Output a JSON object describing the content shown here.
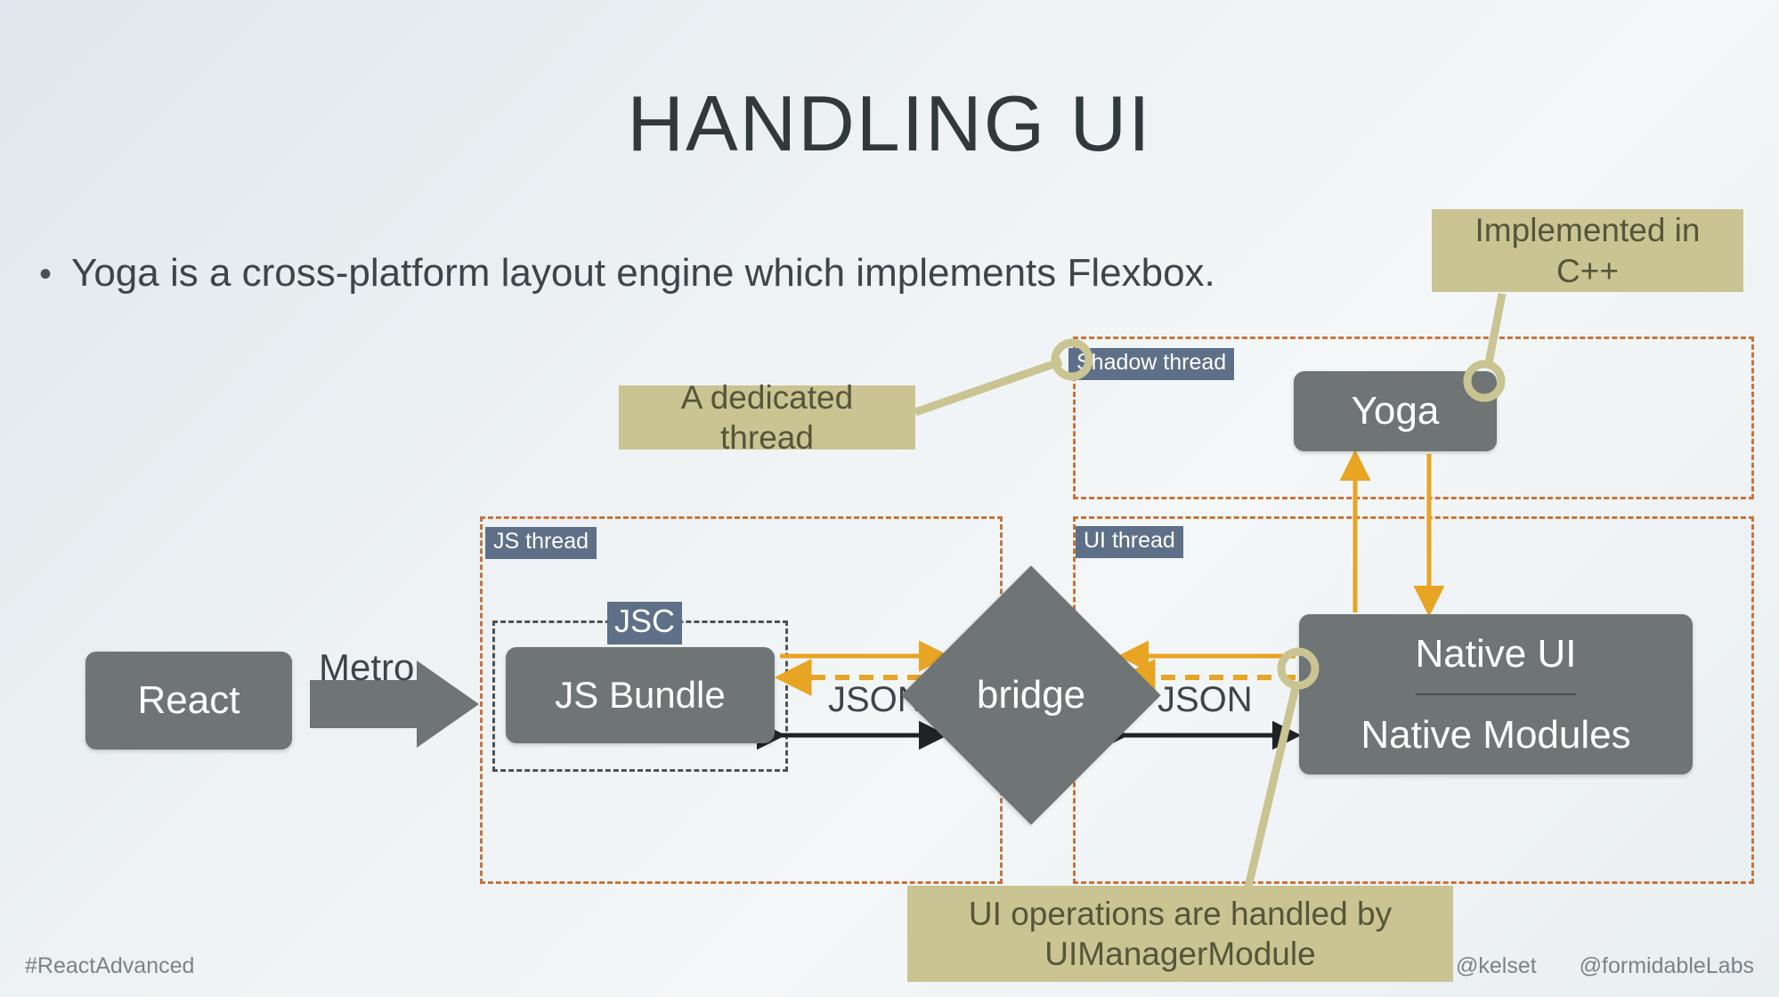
{
  "slide": {
    "title": "HANDLING UI",
    "bullet": {
      "marker": "•",
      "text": "Yoga is a cross-platform layout engine which implements Flexbox."
    }
  },
  "colors": {
    "background_from": "#dfe8ec",
    "background_to": "#e9eef1",
    "node_gray": "#6e7574",
    "thread_border_orange": "#c9733a",
    "chip_blue": "#5d7087",
    "callout_khaki": "#c9c492",
    "callout_text": "#55553a",
    "arrow_orange": "#e8a423",
    "arrow_black": "#1f2326",
    "jsc_border": "#4d5357",
    "title_color": "#32393d",
    "footer_color": "#7b8388"
  },
  "threads": [
    {
      "id": "shadow",
      "label": "Shadow thread"
    },
    {
      "id": "js",
      "label": "JS thread"
    },
    {
      "id": "ui",
      "label": "UI thread"
    }
  ],
  "jsc": {
    "label": "JSC"
  },
  "nodes": {
    "react": "React",
    "js_bundle": "JS Bundle",
    "bridge": "bridge",
    "yoga": "Yoga",
    "native_ui": "Native UI",
    "native_modules": "Native Modules"
  },
  "edges": {
    "metro": "Metro",
    "json_left": "JSON",
    "json_right": "JSON"
  },
  "callouts": {
    "cpp": "Implemented in C++",
    "dedicated_thread": "A dedicated thread",
    "ui_operations": "UI operations are handled by\nUIManagerModule"
  },
  "footer": {
    "hashtag": "#ReactAdvanced",
    "handle_speaker": "@kelset",
    "handle_org": "@formidableLabs"
  }
}
